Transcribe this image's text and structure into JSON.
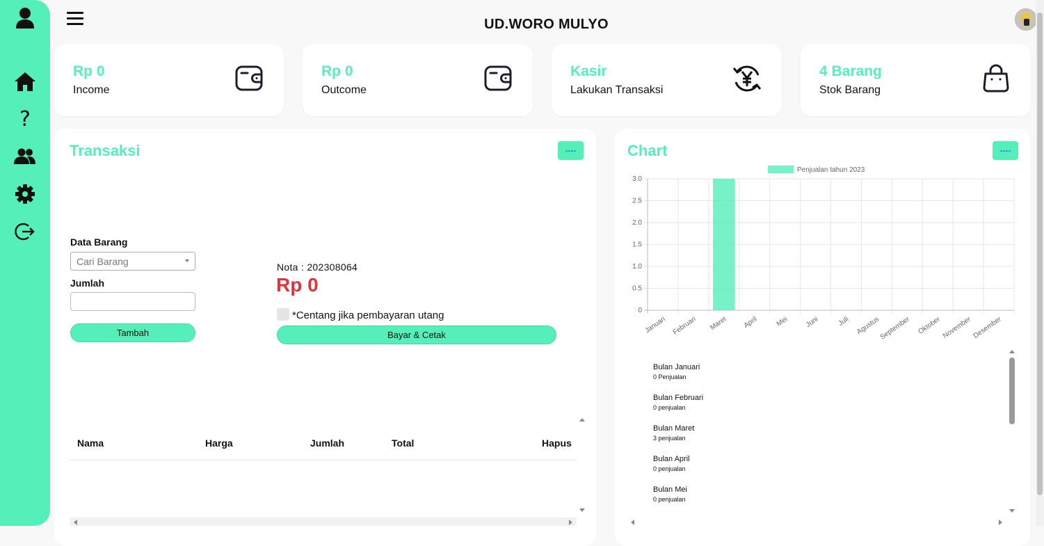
{
  "app": {
    "title": "UD.WORO MULYO"
  },
  "sidebar": {
    "items": [
      {
        "icon": "user-icon"
      },
      {
        "icon": "home-icon"
      },
      {
        "icon": "help-icon",
        "label": "?"
      },
      {
        "icon": "users-icon"
      },
      {
        "icon": "gear-icon"
      },
      {
        "icon": "logout-icon"
      }
    ]
  },
  "cards": [
    {
      "value": "Rp 0",
      "label": "Income",
      "icon": "wallet-icon"
    },
    {
      "value": "Rp 0",
      "label": "Outcome",
      "icon": "wallet-icon"
    },
    {
      "value": "Kasir",
      "label": "Lakukan Transaksi",
      "icon": "yen-exchange-icon"
    },
    {
      "value": "4 Barang",
      "label": "Stok Barang",
      "icon": "shopping-bag-icon"
    }
  ],
  "transaksi": {
    "title": "Transaksi",
    "menu_label": "----",
    "data_barang_label": "Data Barang",
    "search_placeholder": "Cari Barang",
    "jumlah_label": "Jumlah",
    "jumlah_value": "",
    "tambah_label": "Tambah",
    "nota": "Nota : 202308064",
    "total": "Rp 0",
    "utang_label": "*Centang jika pembayaran utang",
    "bayar_label": "Bayar & Cetak",
    "table_headers": [
      "Nama",
      "Harga",
      "Jumlah",
      "Total",
      "Hapus"
    ]
  },
  "chart_panel": {
    "title": "Chart",
    "menu_label": "----",
    "list": [
      {
        "title": "Bulan Januari",
        "sub": "0 Penjualan"
      },
      {
        "title": "Bulan Februari",
        "sub": "0 penjualan"
      },
      {
        "title": "Bulan Maret",
        "sub": "3 penjualan"
      },
      {
        "title": "Bulan April",
        "sub": "0 penjualan"
      },
      {
        "title": "Bulan Mei",
        "sub": "0 penjualan"
      }
    ]
  },
  "chart_data": {
    "type": "bar",
    "categories": [
      "Januari",
      "Februari",
      "Maret",
      "April",
      "Mei",
      "Juni",
      "Juli",
      "Agustus",
      "September",
      "Oktober",
      "November",
      "Desember"
    ],
    "series": [
      {
        "name": "Penjualan tahun 2023",
        "values": [
          0,
          0,
          3,
          0,
          0,
          0,
          0,
          0,
          0,
          0,
          0,
          0
        ],
        "color": "#55efb9"
      }
    ],
    "ylim": [
      0,
      3
    ],
    "yticks": [
      "0",
      "0.5",
      "1.0",
      "1.5",
      "2.0",
      "2.5",
      "3.0"
    ],
    "grid": true,
    "legend": "top"
  },
  "colors": {
    "accent": "#55efb9",
    "danger": "#e0343c",
    "link": "#1a3bff"
  }
}
